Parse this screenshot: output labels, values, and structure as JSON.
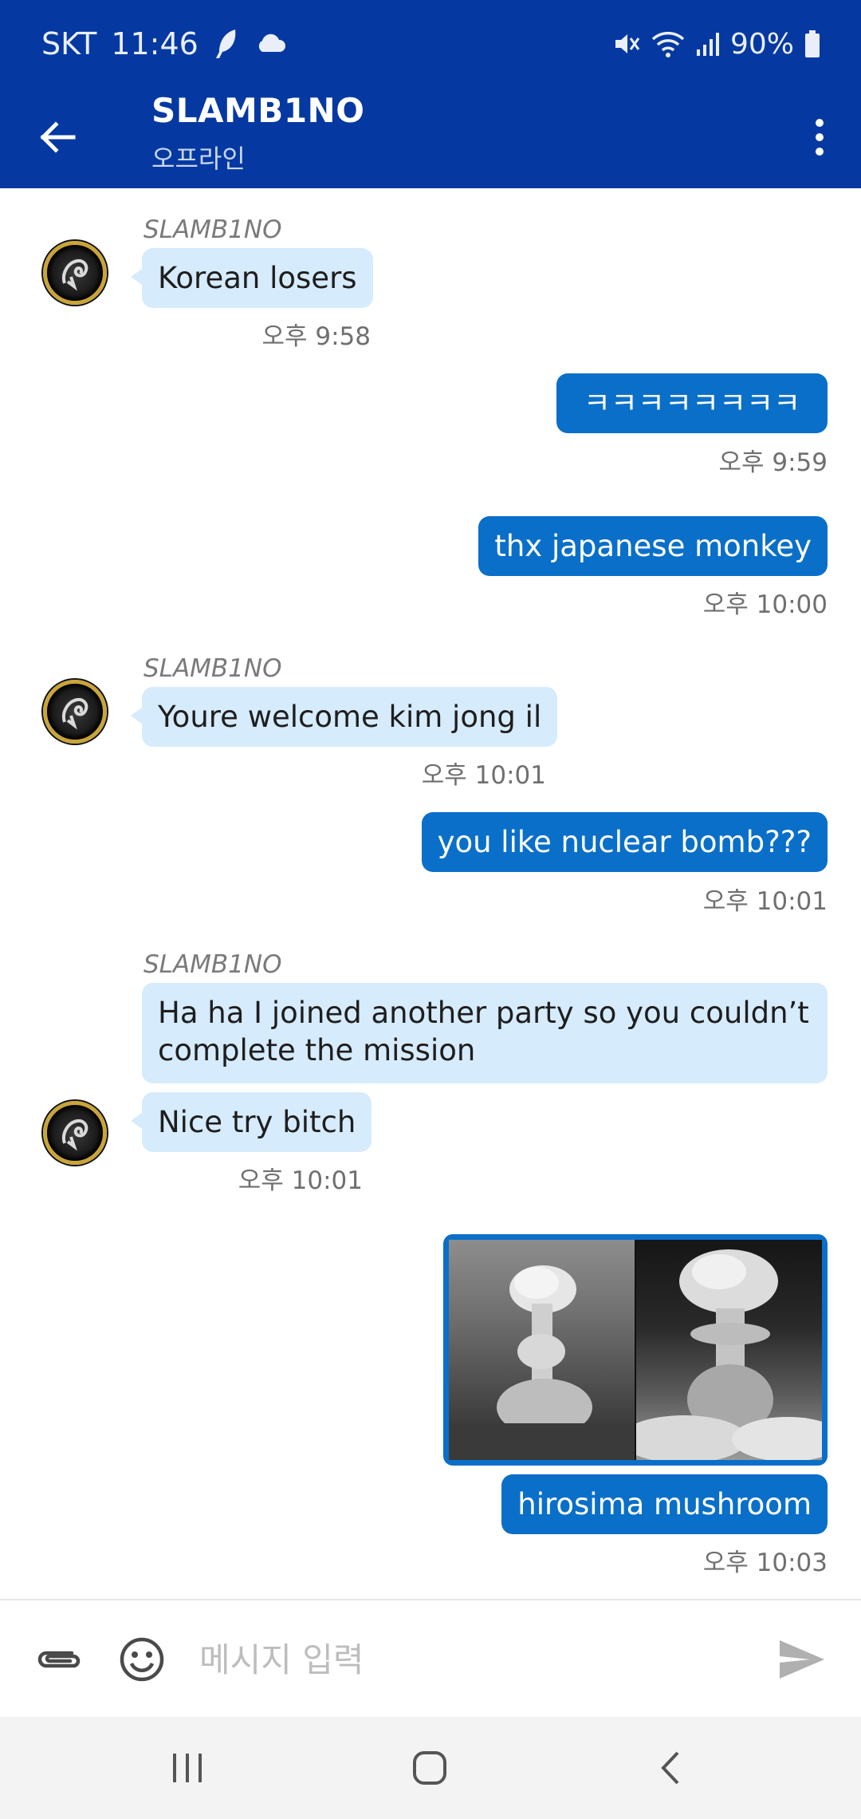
{
  "status_bar": {
    "carrier": "SKT",
    "time": "11:46",
    "battery": "90%",
    "icons": [
      "feather-app-icon",
      "cloud-icon",
      "mute-icon",
      "wifi-icon",
      "signal-icon",
      "battery-icon"
    ]
  },
  "header": {
    "title": "SLAMB1NO",
    "subtitle": "오프라인"
  },
  "messages": [
    {
      "type": "incoming",
      "sender": "SLAMB1NO",
      "text": "Korean losers",
      "time": "오후 9:58"
    },
    {
      "type": "outgoing",
      "text": "ㅋㅋㅋㅋㅋㅋㅋㅋ",
      "time": "오후 9:59"
    },
    {
      "type": "outgoing",
      "text": "thx japanese monkey",
      "time": "오후 10:00"
    },
    {
      "type": "incoming",
      "sender": "SLAMB1NO",
      "text": "Youre welcome kim jong il",
      "time": "오후 10:01"
    },
    {
      "type": "outgoing",
      "text": "you like nuclear bomb???",
      "time": "오후 10:01"
    },
    {
      "type": "incoming",
      "sender": "SLAMB1NO",
      "text": "Ha ha I joined another party so you couldn’t complete the mission"
    },
    {
      "type": "incoming",
      "text": "Nice try bitch",
      "time": "오후 10:01"
    },
    {
      "type": "outgoing-image",
      "text": "hirosima mushroom",
      "time": "오후 10:03"
    }
  ],
  "input": {
    "placeholder": "메시지 입력"
  },
  "colors": {
    "header_bg": "#0539a1",
    "incoming_bubble": "#d6ebfc",
    "outgoing_bubble": "#0a6fc8",
    "time_text": "#6f6f6f",
    "nav_bg": "#f3f3f3"
  }
}
